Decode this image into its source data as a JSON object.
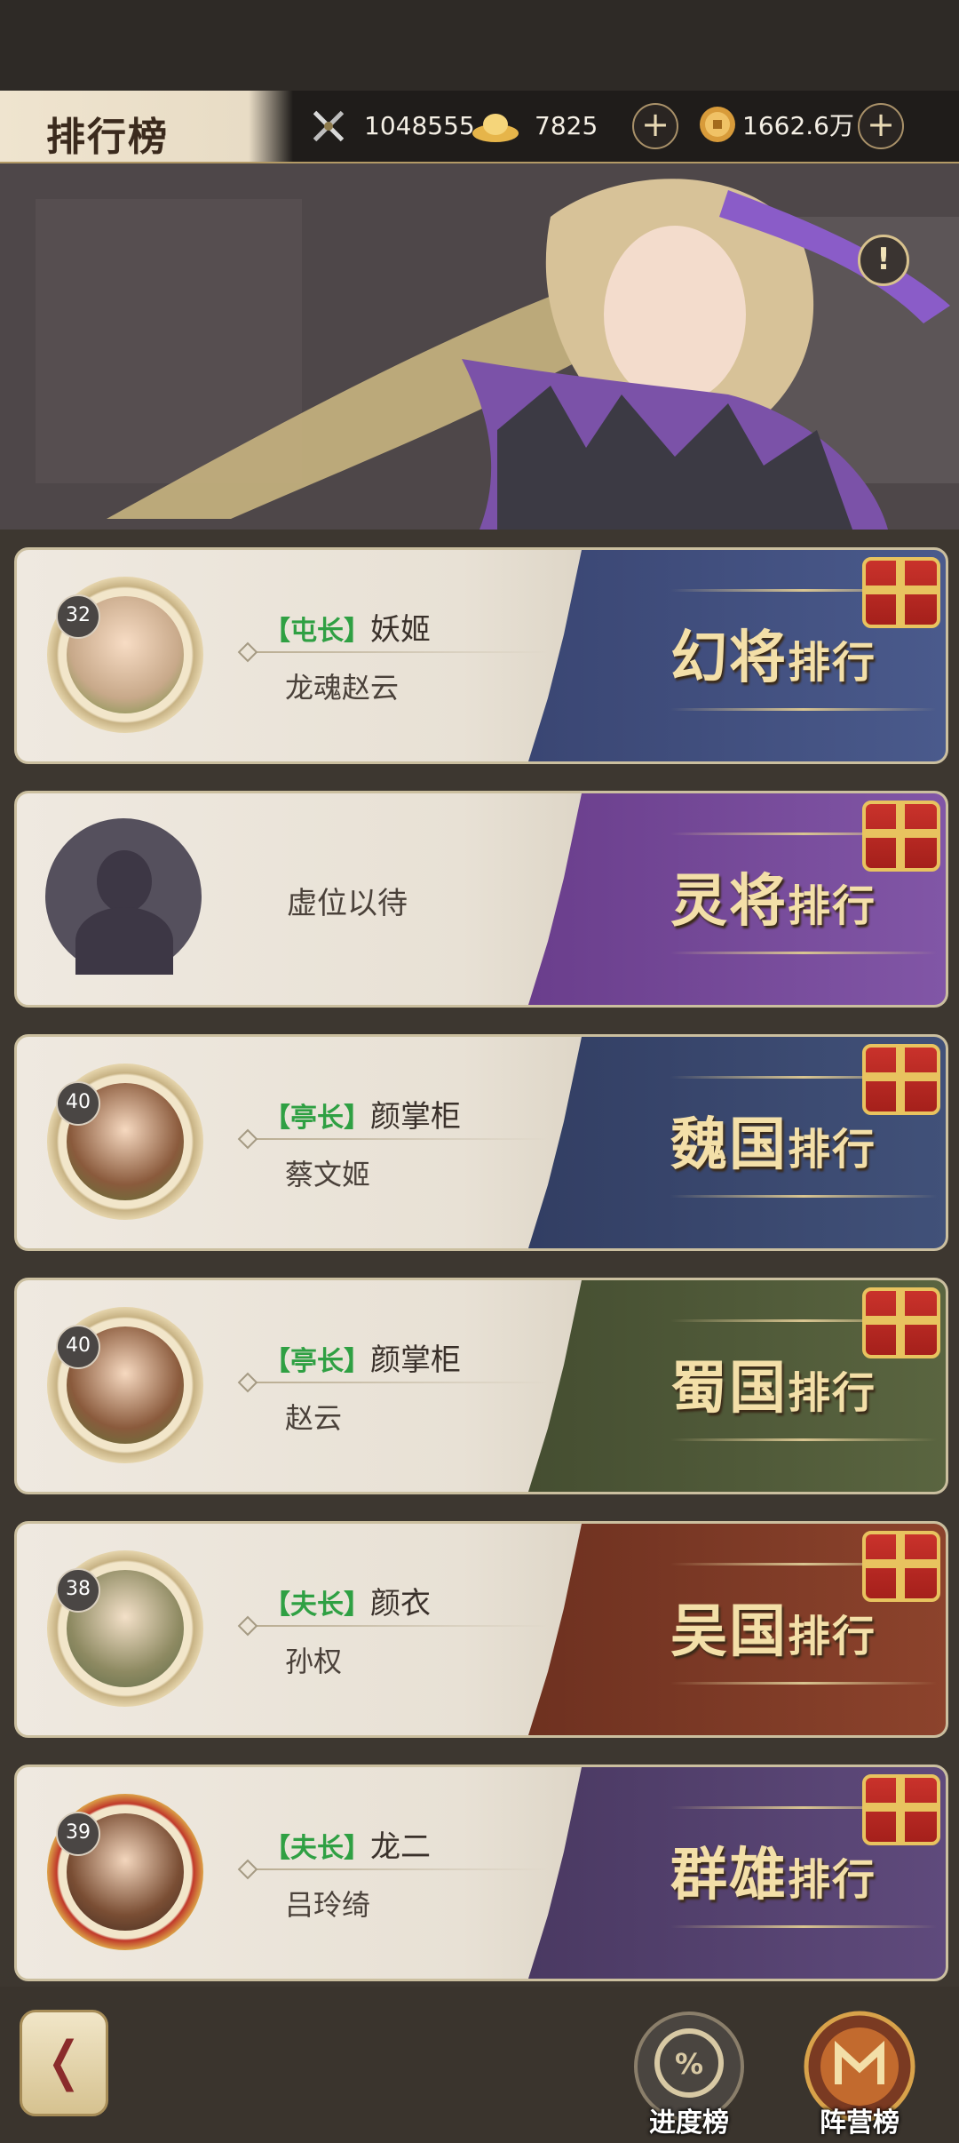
{
  "header": {
    "title": "排行榜",
    "combat_power": "1048555",
    "gold_ingots": "7825",
    "coins": "1662.6万"
  },
  "cards": [
    {
      "level": "32",
      "tag": "【屯长】",
      "name": "妖姬",
      "sub": "龙魂赵云",
      "band_big": "幻将",
      "band_small": "排行",
      "band_color": "#3f4d7a"
    },
    {
      "placeholder": "虚位以待",
      "band_big": "灵将",
      "band_small": "排行",
      "band_color": "#6e418f"
    },
    {
      "level": "40",
      "tag": "【亭长】",
      "name": "颜掌柜",
      "sub": "蔡文姬",
      "band_big": "魏国",
      "band_small": "排行",
      "band_color": "#37446a"
    },
    {
      "level": "40",
      "tag": "【亭长】",
      "name": "颜掌柜",
      "sub": "赵云",
      "band_big": "蜀国",
      "band_small": "排行",
      "band_color": "#4d5636"
    },
    {
      "level": "38",
      "tag": "【夫长】",
      "name": "颜衣",
      "sub": "孙权",
      "band_big": "吴国",
      "band_small": "排行",
      "band_color": "#7d3826"
    },
    {
      "level": "39",
      "tag": "【夫长】",
      "name": "龙二",
      "sub": "吕玲绮",
      "band_big": "群雄",
      "band_small": "排行",
      "band_color": "#54406d"
    }
  ],
  "footer": {
    "progress_label": "进度榜",
    "camp_label": "阵营榜"
  }
}
